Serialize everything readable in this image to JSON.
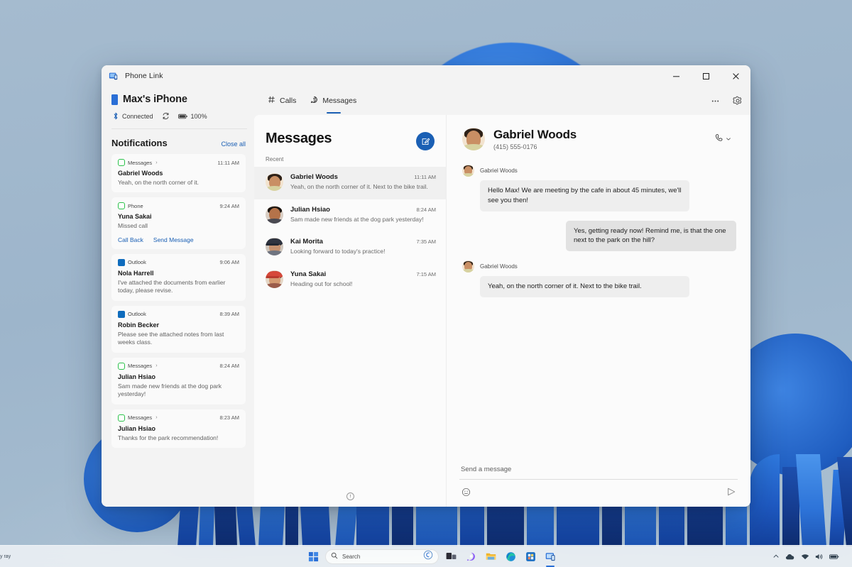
{
  "window": {
    "app_title": "Phone Link",
    "controls": {
      "minimize": "Minimize",
      "maximize": "Maximize",
      "close": "Close",
      "more_options": "More options",
      "settings": "Settings"
    }
  },
  "device": {
    "name": "Max's iPhone",
    "connection_status": "Connected",
    "battery": "100%",
    "sync_label": "Refresh"
  },
  "notifications": {
    "title": "Notifications",
    "close_all_label": "Close all",
    "items": [
      {
        "app": "Messages",
        "app_color": "#2bc24a",
        "has_chevron": true,
        "time": "11:11 AM",
        "sender": "Gabriel Woods",
        "body": "Yeah, on the north corner of it.",
        "actions": []
      },
      {
        "app": "Phone",
        "app_color": "#2bc24a",
        "has_chevron": false,
        "time": "9:24 AM",
        "sender": "Yuna Sakai",
        "body": "Missed call",
        "actions": [
          "Call Back",
          "Send Message"
        ]
      },
      {
        "app": "Outlook",
        "app_color": "#0f6cbd",
        "has_chevron": false,
        "time": "9:06 AM",
        "sender": "Nola Harrell",
        "body": "I've attached the documents from earlier today, please revise.",
        "actions": []
      },
      {
        "app": "Outlook",
        "app_color": "#0f6cbd",
        "has_chevron": false,
        "time": "8:39 AM",
        "sender": "Robin Becker",
        "body": "Please see the attached notes from last weeks class.",
        "actions": []
      },
      {
        "app": "Messages",
        "app_color": "#2bc24a",
        "has_chevron": true,
        "time": "8:24 AM",
        "sender": "Julian Hsiao",
        "body": "Sam made new friends at the dog park yesterday!",
        "actions": []
      },
      {
        "app": "Messages",
        "app_color": "#2bc24a",
        "has_chevron": true,
        "time": "8:23 AM",
        "sender": "Julian Hsiao",
        "body": "Thanks for the park recommendation!",
        "actions": []
      }
    ]
  },
  "tabs": [
    {
      "label": "Calls",
      "icon": "dialpad-icon",
      "active": false
    },
    {
      "label": "Messages",
      "icon": "chat-bubble-icon",
      "active": true
    }
  ],
  "messages_pane": {
    "title": "Messages",
    "section_label": "Recent",
    "compose_tooltip": "New message",
    "threads": [
      {
        "name": "Gabriel Woods",
        "time": "11:11 AM",
        "preview": "Yeah, on the north corner of it. Next to the bike trail.",
        "selected": true,
        "avatar": {
          "skin": "#c98f64",
          "hair": "#2e2118",
          "shirt": "#d7d2a0",
          "bg": "#f2e3cf",
          "type": "man"
        }
      },
      {
        "name": "Julian Hsiao",
        "time": "8:24 AM",
        "preview": "Sam made new friends at the dog park yesterday!",
        "selected": false,
        "avatar": {
          "skin": "#b4734a",
          "hair": "#1a1410",
          "shirt": "#4a4a52",
          "bg": "#d9cec4",
          "type": "man"
        }
      },
      {
        "name": "Kai Morita",
        "time": "7:35 AM",
        "preview": "Looking forward to today's practice!",
        "selected": false,
        "avatar": {
          "skin": "#c59270",
          "hair": "#171310",
          "shirt": "#6f7480",
          "bg": "#cfc6bd",
          "type": "cap"
        }
      },
      {
        "name": "Yuna Sakai",
        "time": "7:15 AM",
        "preview": "Heading out for school!",
        "selected": false,
        "avatar": {
          "skin": "#d39a72",
          "hair": "#221a14",
          "shirt": "#9a5b4a",
          "bg": "#e4d6c6",
          "type": "redhat"
        }
      }
    ]
  },
  "conversation": {
    "contact_name": "Gabriel Woods",
    "contact_phone": "(415) 555-0176",
    "call_button_label": "Call",
    "messages": [
      {
        "direction": "in",
        "sender": "Gabriel Woods",
        "text": "Hello Max! We are meeting by the cafe in about 45 minutes, we'll see you then!"
      },
      {
        "direction": "out",
        "sender": "",
        "text": "Yes, getting ready now! Remind me, is that the one next to the park on the hill?"
      },
      {
        "direction": "in",
        "sender": "Gabriel Woods",
        "text": "Yeah, on the north corner of it. Next to the bike trail."
      }
    ],
    "composer": {
      "placeholder": "Send a message",
      "value": "",
      "emoji_label": "Emoji",
      "send_label": "Send"
    }
  },
  "taskbar": {
    "desktop_label": "y\nray",
    "search_placeholder": "Search",
    "items": [
      {
        "name": "start-button",
        "label": "Start"
      },
      {
        "name": "search-box",
        "label": "Search"
      },
      {
        "name": "copilot-button",
        "label": "Copilot"
      },
      {
        "name": "taskview-button",
        "label": "Task view"
      },
      {
        "name": "chat-button",
        "label": "Chat"
      },
      {
        "name": "file-explorer-button",
        "label": "File Explorer"
      },
      {
        "name": "edge-button",
        "label": "Microsoft Edge"
      },
      {
        "name": "store-button",
        "label": "Microsoft Store"
      },
      {
        "name": "phone-link-button",
        "label": "Phone Link"
      }
    ],
    "tray": [
      {
        "name": "show-hidden-icons",
        "label": "Show hidden icons"
      },
      {
        "name": "onedrive-icon",
        "label": "OneDrive"
      },
      {
        "name": "wifi-icon",
        "label": "Network"
      },
      {
        "name": "volume-icon",
        "label": "Volume"
      },
      {
        "name": "battery-icon",
        "label": "Battery"
      }
    ]
  },
  "colors": {
    "accent": "#1a5fb4",
    "taskbar_accent": "#2a6fd6",
    "desktop_bg": "#9fb6cb",
    "window_bg": "#f3f3f3",
    "pane_bg": "#fbfbfb",
    "bubble_in": "#eeeeee",
    "bubble_out": "#e2e2e2"
  }
}
